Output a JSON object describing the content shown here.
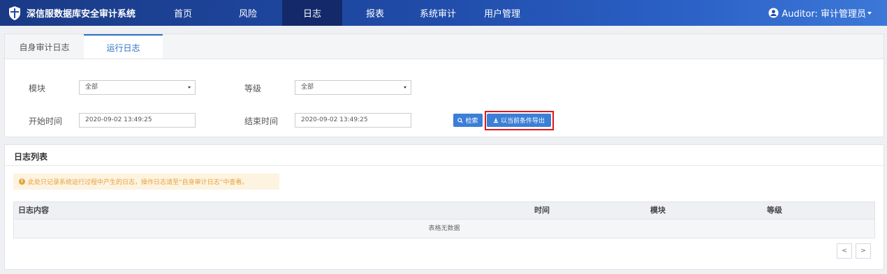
{
  "app": {
    "title": "深信服数据库安全审计系统"
  },
  "nav": {
    "items": [
      {
        "label": "首页",
        "active": false
      },
      {
        "label": "风险",
        "active": false
      },
      {
        "label": "日志",
        "active": true
      },
      {
        "label": "报表",
        "active": false
      },
      {
        "label": "系统审计",
        "active": false
      },
      {
        "label": "用户管理",
        "active": false
      }
    ]
  },
  "user": {
    "label": "Auditor: 审计管理员",
    "icon": "user-circle-icon"
  },
  "tabs": [
    {
      "label": "自身审计日志",
      "active": false
    },
    {
      "label": "运行日志",
      "active": true
    }
  ],
  "filters": {
    "module_label": "模块",
    "module_value": "全部",
    "level_label": "等级",
    "level_value": "全部",
    "start_label": "开始时间",
    "start_value": "2020-09-02 13:49:25",
    "end_label": "结束时间",
    "end_value": "2020-09-02 13:49:25",
    "search_button": "检索",
    "export_button": "以当前条件导出"
  },
  "list": {
    "title": "日志列表",
    "notice": "此处只记录系统运行过程中产生的日志，操作日志请至“自身审计日志”中查看。",
    "columns": [
      "日志内容",
      "时间",
      "模块",
      "等级"
    ],
    "empty_text": "表格无数据",
    "pager_prev": "<",
    "pager_next": ">"
  },
  "colors": {
    "nav_bg": "#1f4aa6",
    "nav_active": "#13296a",
    "accent": "#2d6fc6",
    "button": "#3b7fd6",
    "highlight": "#e0161b",
    "notice_text": "#e6a23c"
  }
}
